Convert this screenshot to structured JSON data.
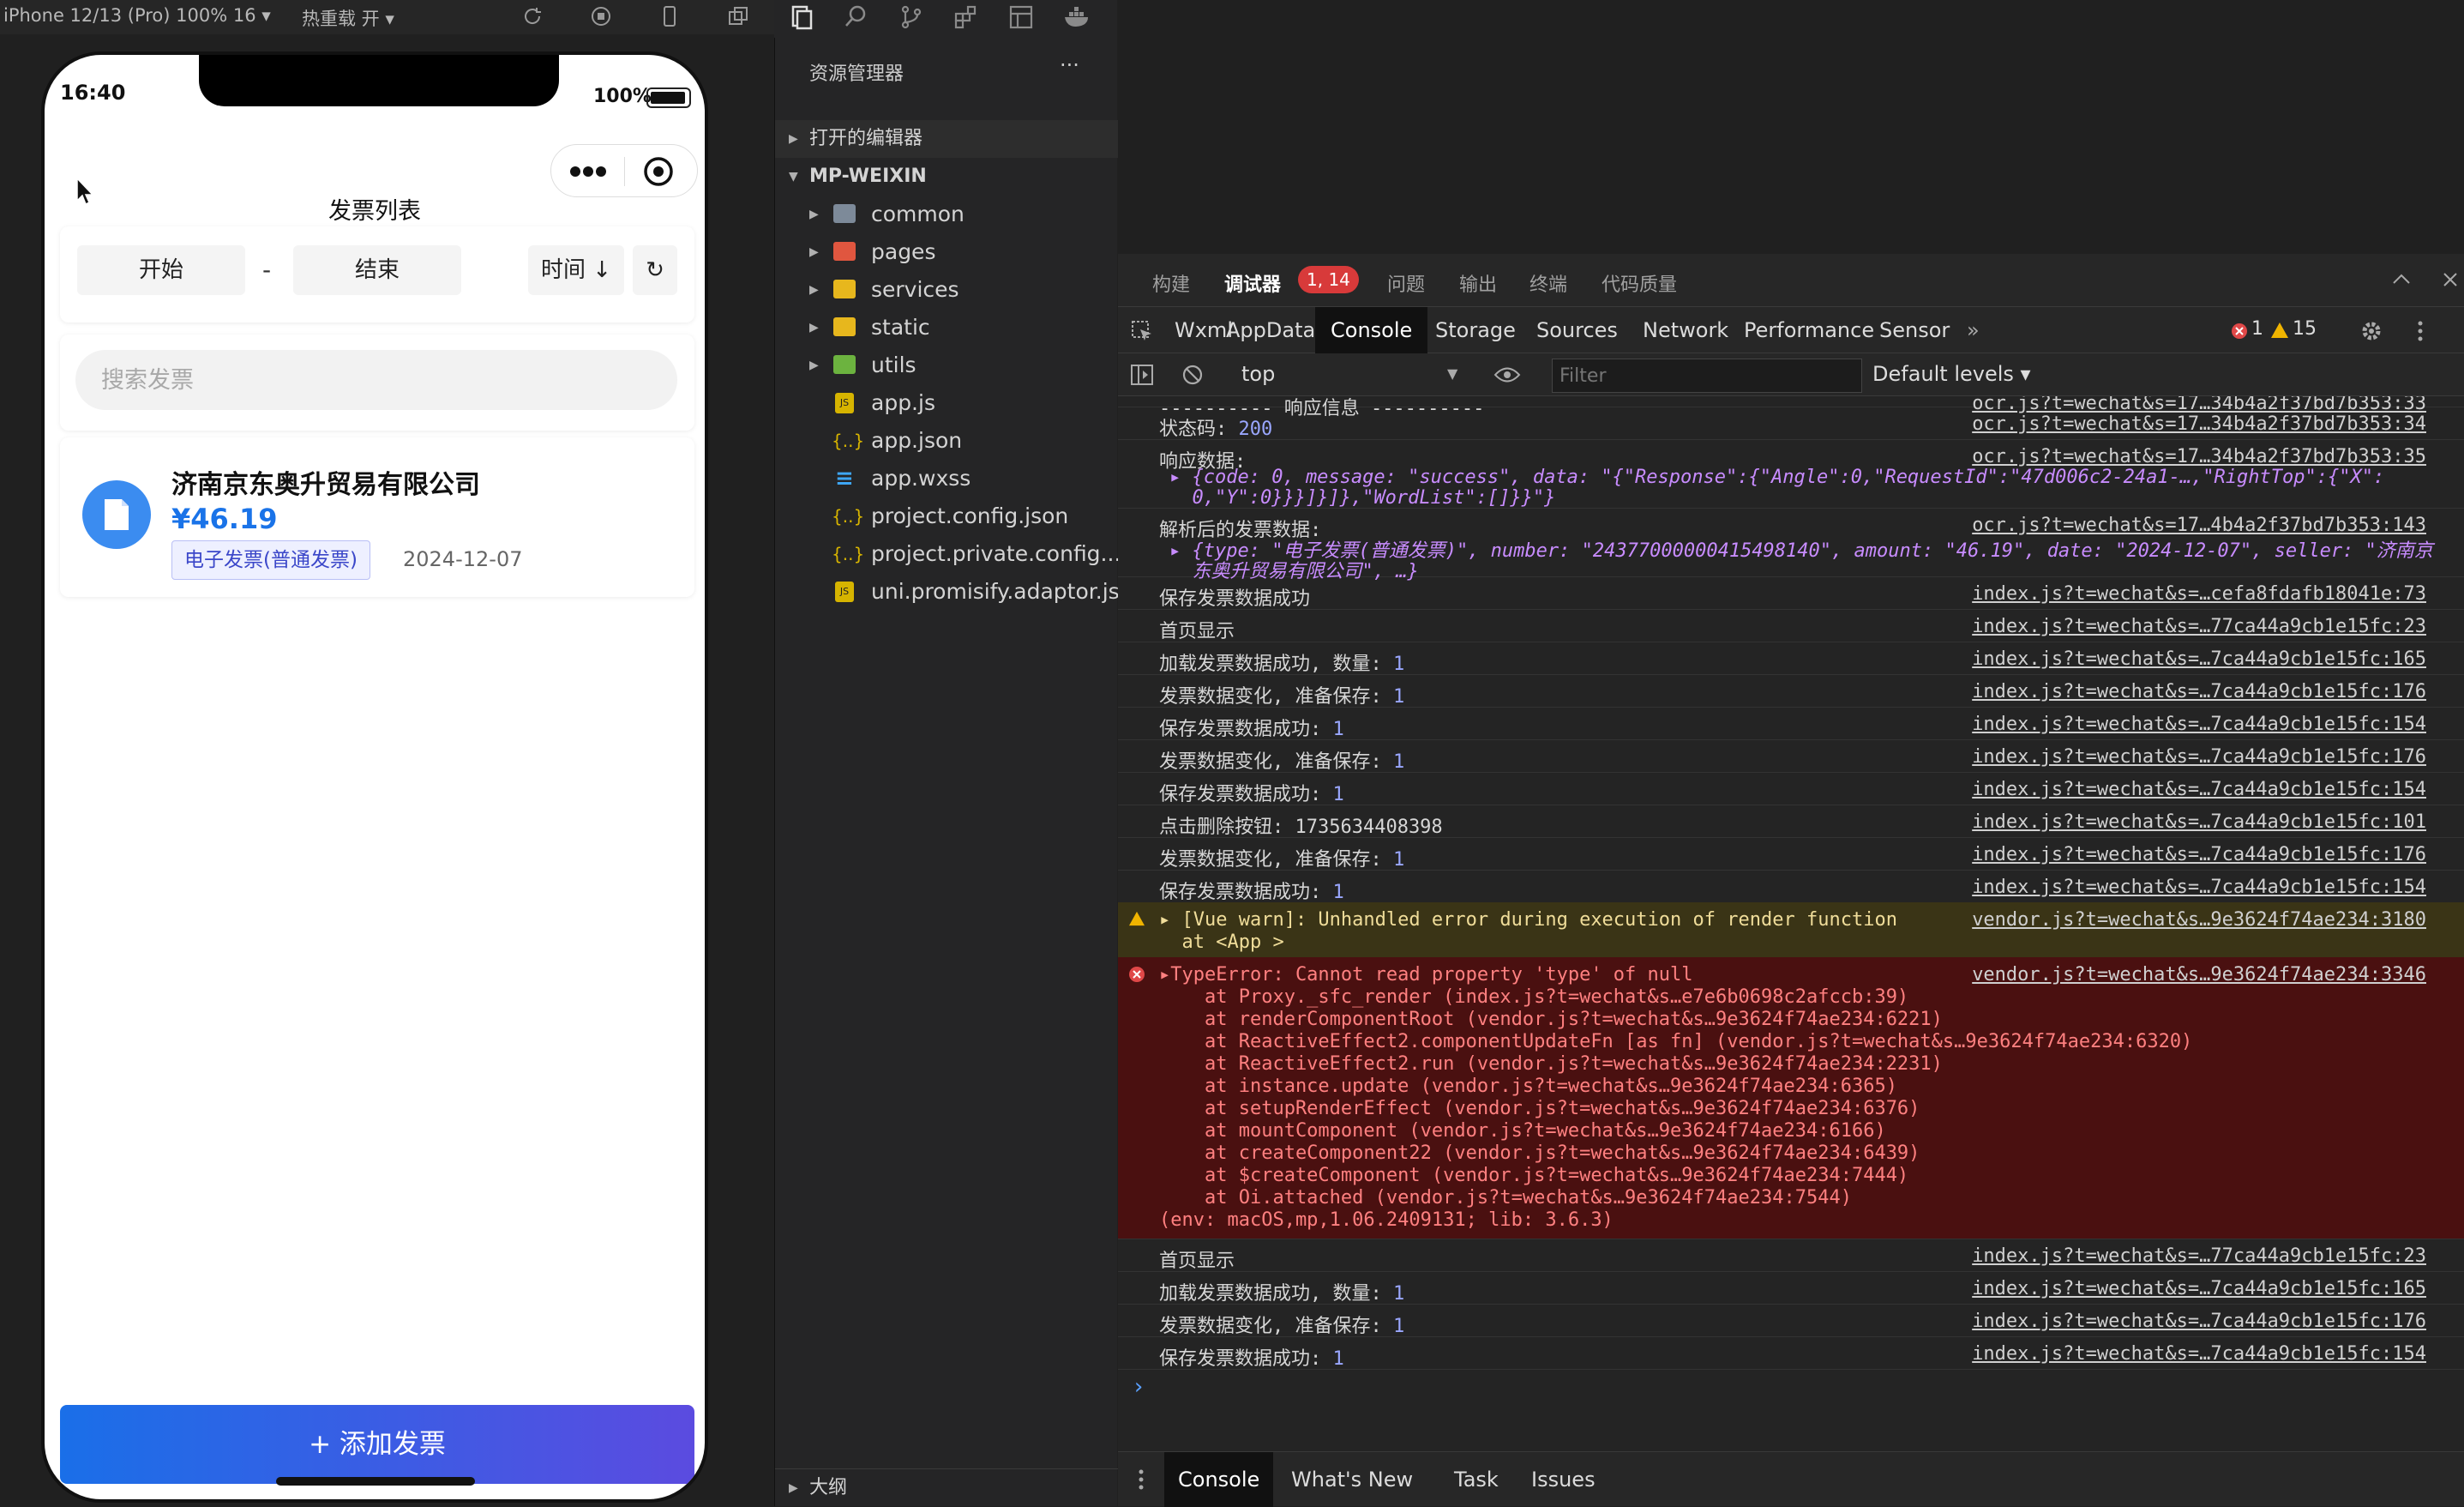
{
  "simulator": {
    "device": "iPhone 12/13 (Pro) 100% 16 ▾",
    "hot_reload": "热重载 开 ▾",
    "status_time": "16:40",
    "status_battery": "100%"
  },
  "app": {
    "nav_title": "发票列表",
    "filter": {
      "start": "开始",
      "sep": "-",
      "end": "结束",
      "sort": "时间 ↓",
      "refresh": "↻"
    },
    "search_placeholder": "搜索发票",
    "invoice": {
      "company": "济南京东奥升贸易有限公司",
      "amount": "¥46.19",
      "type": "电子发票(普通发票)",
      "date": "2024-12-07"
    },
    "add_button": "+ 添加发票"
  },
  "explorer": {
    "title": "资源管理器",
    "more": "···",
    "open_editors": "打开的编辑器",
    "root": "MP-WEIXIN",
    "folders": [
      "common",
      "pages",
      "services",
      "static",
      "utils"
    ],
    "files": [
      "app.js",
      "app.json",
      "app.wxss",
      "project.config.json",
      "project.private.config...",
      "uni.promisify.adaptor.js"
    ],
    "outline": "大纲"
  },
  "devtools": {
    "top_tabs": [
      "构建",
      "调试器",
      "问题",
      "输出",
      "终端",
      "代码质量"
    ],
    "top_badge": "1, 14",
    "panel_tabs": [
      "Wxml",
      "AppData",
      "Console",
      "Storage",
      "Sources",
      "Network",
      "Performance",
      "Sensor"
    ],
    "more_tabs": "»",
    "error_count": "1",
    "warn_count": "15",
    "context": "top",
    "filter_placeholder": "Filter",
    "levels": "Default levels ▾",
    "bottom_tabs": [
      "Console",
      "What's New",
      "Task",
      "Issues"
    ],
    "prompt": "›"
  },
  "console": [
    {
      "msg": "---------- 响应信息 ----------",
      "src": "ocr.js?t=wechat&s=17…34b4a2f37bd7b353:33"
    },
    {
      "msg": "状态码: ",
      "num": "200",
      "src": "ocr.js?t=wechat&s=17…34b4a2f37bd7b353:34"
    },
    {
      "msg": "响应数据:",
      "src": "ocr.js?t=wechat&s=17…34b4a2f37bd7b353:35"
    },
    {
      "msg": "▸ {code: 0, message: \"success\", data: \"{\"Response\":{\"Angle\":0,\"RequestId\":\"47d006c2-24a1-…,\"RightTop\":{\"X\":"
    },
    {
      "msg": "  0,\"Y\":0}}}]}]},\"WordList\":[]}}\"}"
    },
    {
      "msg": "解析后的发票数据:",
      "src": "ocr.js?t=wechat&s=17…4b4a2f37bd7b353:143"
    },
    {
      "msg": "▸ {type: \"电子发票(普通发票)\", number: \"24377000000415498140\", amount: \"46.19\", date: \"2024-12-07\", seller: \"济南京"
    },
    {
      "msg": "  东奥升贸易有限公司\", …}"
    },
    {
      "msg": "保存发票数据成功",
      "src": "index.js?t=wechat&s=…cefa8fdafb18041e:73"
    },
    {
      "msg": "首页显示",
      "src": "index.js?t=wechat&s=…77ca44a9cb1e15fc:23"
    },
    {
      "msg": "加载发票数据成功, 数量: ",
      "num": "1",
      "src": "index.js?t=wechat&s=…7ca44a9cb1e15fc:165"
    },
    {
      "msg": "发票数据变化, 准备保存: ",
      "num": "1",
      "src": "index.js?t=wechat&s=…7ca44a9cb1e15fc:176"
    },
    {
      "msg": "保存发票数据成功: ",
      "num": "1",
      "src": "index.js?t=wechat&s=…7ca44a9cb1e15fc:154"
    },
    {
      "msg": "发票数据变化, 准备保存: ",
      "num": "1",
      "src": "index.js?t=wechat&s=…7ca44a9cb1e15fc:176"
    },
    {
      "msg": "保存发票数据成功: ",
      "num": "1",
      "src": "index.js?t=wechat&s=…7ca44a9cb1e15fc:154"
    },
    {
      "msg": "点击删除按钮: 1735634408398",
      "src": "index.js?t=wechat&s=…7ca44a9cb1e15fc:101"
    },
    {
      "msg": "发票数据变化, 准备保存: ",
      "num": "1",
      "src": "index.js?t=wechat&s=…7ca44a9cb1e15fc:176"
    },
    {
      "msg": "保存发票数据成功: ",
      "num": "1",
      "src": "index.js?t=wechat&s=…7ca44a9cb1e15fc:154"
    }
  ],
  "warn": {
    "line1": "▸ [Vue warn]: Unhandled error during execution of render function",
    "line2": "  at <App >",
    "src": "vendor.js?t=wechat&s…9e3624f74ae234:3180"
  },
  "error": {
    "lines": [
      "▸TypeError: Cannot read property 'type' of null",
      "    at Proxy._sfc_render (index.js?t=wechat&s…e7e6b0698c2afccb:39)",
      "    at renderComponentRoot (vendor.js?t=wechat&s…9e3624f74ae234:6221)",
      "    at ReactiveEffect2.componentUpdateFn [as fn] (vendor.js?t=wechat&s…9e3624f74ae234:6320)",
      "    at ReactiveEffect2.run (vendor.js?t=wechat&s…9e3624f74ae234:2231)",
      "    at instance.update (vendor.js?t=wechat&s…9e3624f74ae234:6365)",
      "    at setupRenderEffect (vendor.js?t=wechat&s…9e3624f74ae234:6376)",
      "    at mountComponent (vendor.js?t=wechat&s…9e3624f74ae234:6166)",
      "    at createComponent22 (vendor.js?t=wechat&s…9e3624f74ae234:6439)",
      "    at $createComponent (vendor.js?t=wechat&s…9e3624f74ae234:7444)",
      "    at Oi.attached (vendor.js?t=wechat&s…9e3624f74ae234:7544)",
      "(env: macOS,mp,1.06.2409131; lib: 3.6.3)"
    ],
    "src": "vendor.js?t=wechat&s…9e3624f74ae234:3346"
  },
  "console_after": [
    {
      "msg": "首页显示",
      "src": "index.js?t=wechat&s=…77ca44a9cb1e15fc:23"
    },
    {
      "msg": "加载发票数据成功, 数量: ",
      "num": "1",
      "src": "index.js?t=wechat&s=…7ca44a9cb1e15fc:165"
    },
    {
      "msg": "发票数据变化, 准备保存: ",
      "num": "1",
      "src": "index.js?t=wechat&s=…7ca44a9cb1e15fc:176"
    },
    {
      "msg": "保存发票数据成功: ",
      "num": "1",
      "src": "index.js?t=wechat&s=…7ca44a9cb1e15fc:154"
    }
  ],
  "colors": {
    "accent": "#1a73e8",
    "error_bg": "#4a1010",
    "error_text": "#ff8080",
    "warn_bg": "#3a3416",
    "warn_text": "#f0dd9a"
  }
}
